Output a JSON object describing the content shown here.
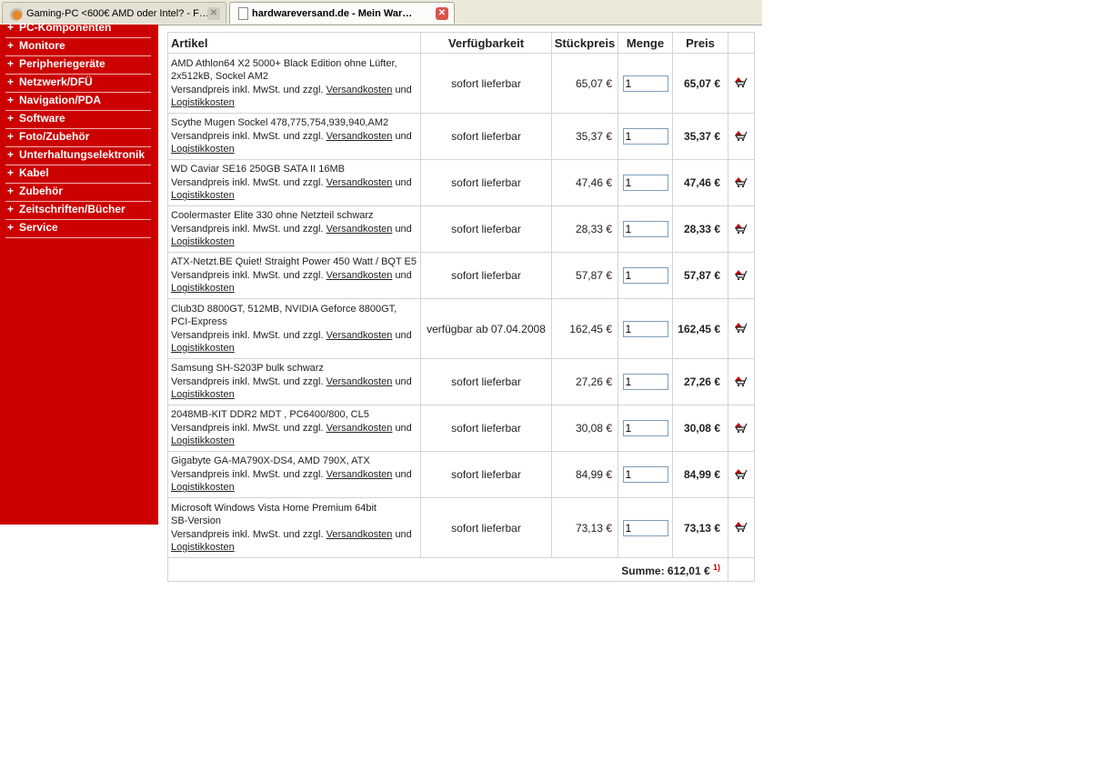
{
  "browser": {
    "tabs": [
      {
        "title": "Gaming-PC <600€ AMD oder Intel? - F…",
        "active": false
      },
      {
        "title": "hardwareversand.de - Mein War…",
        "active": true
      }
    ]
  },
  "sidebar": {
    "items": [
      {
        "label": "PC-Komponenten"
      },
      {
        "label": "Monitore"
      },
      {
        "label": "Peripheriegeräte"
      },
      {
        "label": "Netzwerk/DFÜ"
      },
      {
        "label": "Navigation/PDA"
      },
      {
        "label": "Software"
      },
      {
        "label": "Foto/Zubehör"
      },
      {
        "label": "Unterhaltungselektronik"
      },
      {
        "label": "Kabel"
      },
      {
        "label": "Zubehör"
      },
      {
        "label": "Zeitschriften/Bücher"
      },
      {
        "label": "Service"
      }
    ]
  },
  "cart": {
    "headers": {
      "artikel": "Artikel",
      "availability": "Verfügbarkeit",
      "unit_price": "Stückpreis",
      "quantity": "Menge",
      "price": "Preis"
    },
    "shipping_text": "Versandpreis inkl. MwSt. und zzgl.",
    "shipping_link": "Versandkosten",
    "and_text": "und",
    "logistics_link": "Logistikkosten",
    "items": [
      {
        "name_lines": [
          "AMD Athlon64 X2 5000+ Black Edition ohne Lüfter,",
          "2x512kB, Sockel AM2"
        ],
        "availability": "sofort lieferbar",
        "unit_price": "65,07 €",
        "quantity": "1",
        "price": "65,07 €"
      },
      {
        "name_lines": [
          "Scythe Mugen Sockel 478,775,754,939,940,AM2"
        ],
        "availability": "sofort lieferbar",
        "unit_price": "35,37 €",
        "quantity": "1",
        "price": "35,37 €"
      },
      {
        "name_lines": [
          "WD Caviar SE16 250GB SATA II 16MB"
        ],
        "availability": "sofort lieferbar",
        "unit_price": "47,46 €",
        "quantity": "1",
        "price": "47,46 €"
      },
      {
        "name_lines": [
          "Coolermaster Elite 330 ohne Netzteil schwarz"
        ],
        "availability": "sofort lieferbar",
        "unit_price": "28,33 €",
        "quantity": "1",
        "price": "28,33 €"
      },
      {
        "name_lines": [
          "ATX-Netzt.BE Quiet! Straight Power 450 Watt / BQT E5"
        ],
        "availability": "sofort lieferbar",
        "unit_price": "57,87 €",
        "quantity": "1",
        "price": "57,87 €"
      },
      {
        "name_lines": [
          "Club3D 8800GT, 512MB, NVIDIA Geforce 8800GT,",
          "PCI-Express"
        ],
        "availability": "verfügbar ab 07.04.2008",
        "unit_price": "162,45 €",
        "quantity": "1",
        "price": "162,45 €"
      },
      {
        "name_lines": [
          "Samsung SH-S203P bulk schwarz"
        ],
        "availability": "sofort lieferbar",
        "unit_price": "27,26 €",
        "quantity": "1",
        "price": "27,26 €"
      },
      {
        "name_lines": [
          "2048MB-KIT DDR2 MDT , PC6400/800, CL5"
        ],
        "availability": "sofort lieferbar",
        "unit_price": "30,08 €",
        "quantity": "1",
        "price": "30,08 €"
      },
      {
        "name_lines": [
          "Gigabyte GA-MA790X-DS4, AMD 790X, ATX"
        ],
        "availability": "sofort lieferbar",
        "unit_price": "84,99 €",
        "quantity": "1",
        "price": "84,99 €"
      },
      {
        "name_lines": [
          "Microsoft Windows Vista Home Premium 64bit",
          "SB-Version"
        ],
        "availability": "sofort lieferbar",
        "unit_price": "73,13 €",
        "quantity": "1",
        "price": "73,13 €"
      }
    ],
    "sum_label": "Summe:",
    "sum_value": "612,01 €",
    "sum_footnote": "1)"
  },
  "colors": {
    "sidebar": "#cc0000",
    "remove_icon": "#cc0000"
  },
  "icons": {
    "remove": "cart-remove-icon"
  }
}
